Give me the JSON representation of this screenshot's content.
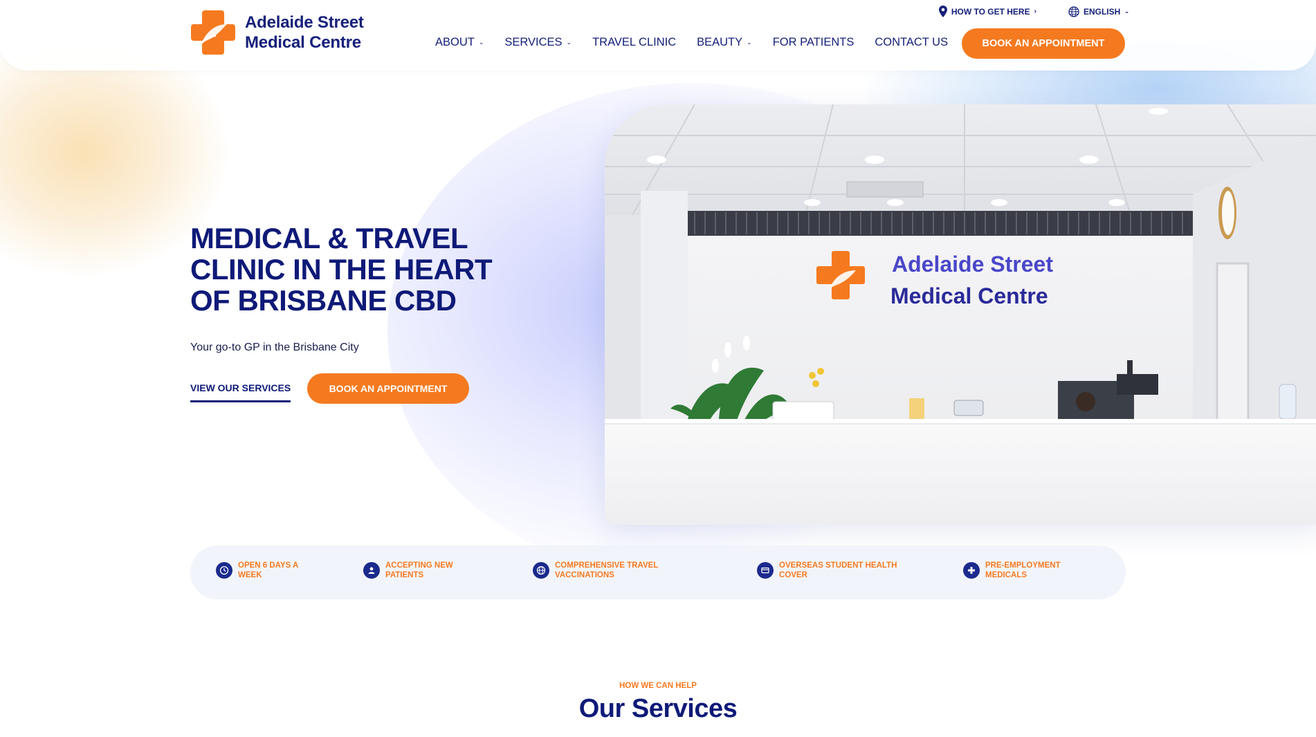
{
  "brand": {
    "name_line1": "Adelaide Street",
    "name_line2": "Medical Centre",
    "colors": {
      "orange": "#f57a1f",
      "navy": "#0f1a78"
    }
  },
  "topbar": {
    "directions_label": "HOW TO GET HERE",
    "directions_icon": "map-pin-icon",
    "language_label": "ENGLISH",
    "language_icon": "globe-icon"
  },
  "nav": {
    "items": [
      {
        "label": "ABOUT",
        "has_dropdown": true
      },
      {
        "label": "SERVICES",
        "has_dropdown": true
      },
      {
        "label": "TRAVEL CLINIC",
        "has_dropdown": false
      },
      {
        "label": "BEAUTY",
        "has_dropdown": true
      },
      {
        "label": "FOR PATIENTS",
        "has_dropdown": false
      },
      {
        "label": "CONTACT US",
        "has_dropdown": false
      }
    ],
    "cta_label": "BOOK AN APPOINTMENT"
  },
  "hero": {
    "title_line1": "MEDICAL & TRAVEL",
    "title_line2": "CLINIC IN THE HEART",
    "title_line3": "OF BRISBANE CBD",
    "subtitle": "Your go-to GP in the Brisbane City",
    "secondary_link": "VIEW OUR SERVICES",
    "cta_label": "BOOK AN APPOINTMENT",
    "photo_sign_line1": "Adelaide Street",
    "photo_sign_line2": "Medical Centre"
  },
  "features": [
    {
      "label": "OPEN 6 DAYS A WEEK",
      "icon": "clock-icon"
    },
    {
      "label": "ACCEPTING NEW PATIENTS",
      "icon": "patient-icon"
    },
    {
      "label": "COMPREHENSIVE TRAVEL VACCINATIONS",
      "icon": "globe-icon"
    },
    {
      "label": "OVERSEAS STUDENT HEALTH COVER",
      "icon": "card-icon"
    },
    {
      "label": "PRE-EMPLOYMENT MEDICALS",
      "icon": "medical-icon"
    }
  ],
  "services": {
    "eyebrow": "HOW WE CAN HELP",
    "title": "Our Services"
  }
}
